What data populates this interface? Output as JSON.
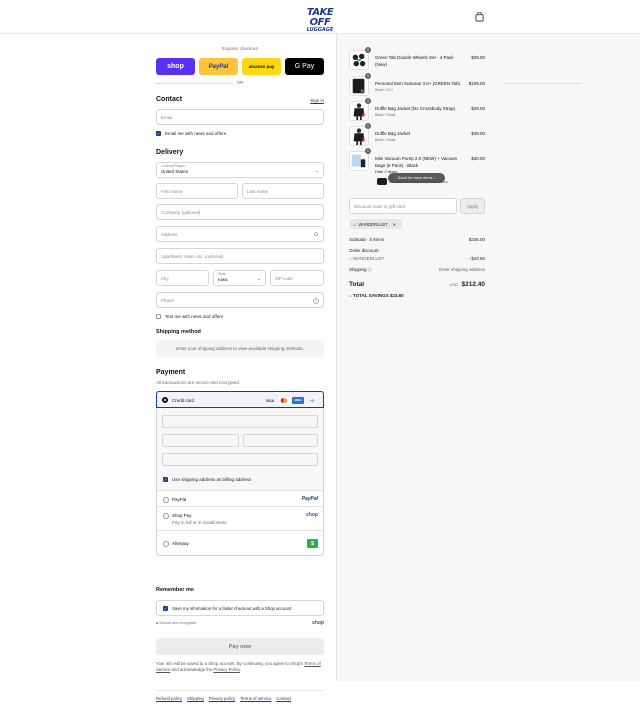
{
  "header": {
    "logo_main": "TAKE OFF",
    "logo_sub": "LUGGAGE",
    "bag_icon": "shopping-bag-icon",
    "brand_color": "#1a3a8c"
  },
  "express": {
    "label": "Express checkout",
    "shop": "shop",
    "paypal": "PayPal",
    "amazon": "amazon pay",
    "gpay": "G Pay",
    "or": "OR"
  },
  "contact": {
    "title": "Contact",
    "sign_in": "Sign in",
    "email_placeholder": "Email",
    "news_label": "Email me with news and offers",
    "news_checked": true
  },
  "delivery": {
    "title": "Delivery",
    "country_label": "Country/Region",
    "country_value": "United States",
    "first_name": "First name",
    "last_name": "Last name",
    "company": "Company (optional)",
    "address": "Address",
    "apartment": "Apartment, suite, etc. (optional)",
    "city": "City",
    "state_label": "State",
    "state_value": "Iowa",
    "zip": "ZIP code",
    "phone": "Phone",
    "text_label": "Text me with news and offers",
    "text_checked": false
  },
  "shipping": {
    "title": "Shipping method",
    "message": "Enter your shipping address to view available shipping methods."
  },
  "payment": {
    "title": "Payment",
    "subtitle": "All transactions are secure and encrypted.",
    "credit_card": "Credit card",
    "cards": [
      "VISA",
      "MC",
      "AMEX",
      "+5"
    ],
    "billing_label": "Use shipping address as billing address",
    "paypal": "PayPal",
    "shop_pay": "Shop Pay",
    "shop_pay_sub": "Pay in full or in installments",
    "shop_pay_logo": "shop",
    "afterpay": "Afterpay"
  },
  "remember": {
    "title": "Remember me",
    "save_label": "Save my information for a faster checkout with a Shop account",
    "secure": "Secure and encrypted",
    "shop": "shop"
  },
  "pay_now": "Pay now",
  "legal": {
    "text_1": "Your info will be saved to a Shop account. By continuing, you agree to Shop's",
    "terms": "Terms of Service",
    "text_2": "and acknowledge the",
    "privacy": "Privacy Policy"
  },
  "footer": {
    "links": [
      "Refund policy",
      "Shipping",
      "Privacy policy",
      "Terms of service",
      "Contact"
    ]
  },
  "cart": {
    "items": [
      {
        "name": "Green Tab Double Wheels Set - 4 Pack (New)",
        "variant": "",
        "price": "$29.00",
        "qty": "1"
      },
      {
        "name": "Personal Item Suitcase 3.0+ (GREEN Tab)",
        "variant": "Black / 3.0+",
        "price": "$109.00",
        "qty": "1"
      },
      {
        "name": "Duffle Bag Jacket (No Crossbody Strap)",
        "variant": "Black / Small",
        "price": "$29.00",
        "qty": "1"
      },
      {
        "name": "Duffle Bag Jacket",
        "variant": "Black / Small",
        "price": "$39.00",
        "qty": "1"
      },
      {
        "name": "Mini Vacuum Pump 2.0 (NEW) + Vacuum Bags (5 Pack) - Black",
        "variant": "Hide 2 items",
        "price": "$30.00",
        "qty": "1"
      }
    ],
    "sub_item": "Mini Vacuum Pump 2.0 (NEW) - Black",
    "scroll_pill": "Scroll for more items",
    "discount_placeholder": "Discount code or gift card",
    "apply": "Apply",
    "code": "WANDERLUST",
    "subtotal_label": "Subtotal · 5 items",
    "subtotal": "$236.00",
    "order_discount": "Order discount",
    "discount_code": "WANDERLUST",
    "discount_value": "- $23.60",
    "shipping_label": "Shipping",
    "shipping_value": "Enter shipping address",
    "total_label": "Total",
    "currency": "USD",
    "total": "$212.40",
    "savings_label": "TOTAL SAVINGS",
    "savings": "$23.60"
  }
}
